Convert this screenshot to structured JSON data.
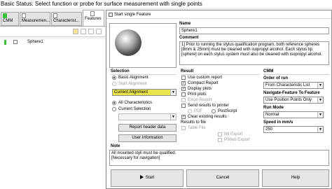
{
  "status_bar": {
    "text": "Basic Status: Select function or probe for surface measurement with single points"
  },
  "left_tabs": [
    {
      "label": "CMM"
    },
    {
      "label": "Measuremen..."
    },
    {
      "label": "Characterist..."
    },
    {
      "label": "Features"
    }
  ],
  "feature_list": [
    {
      "label": "Sphere1"
    }
  ],
  "dialog": {
    "title": "Start single Feature",
    "name_label": "Name",
    "name_value": "Sphere1",
    "comment_label": "Comment",
    "comment_text": "1] Prior to running the stylus qualification program, both reference spheres [8mm & 25mm] must be cleaned with isopropyl alcohol. Each stylus tip [sphere] on each stylus system must also be cleaned with isopropyl alcohol.",
    "selection": {
      "label": "Selection",
      "basic_alignment": "Basic Alignment",
      "start_alignment": "Start Alignment",
      "alignment_value": "Current Alignment",
      "all_characteristics": "All Characteristics",
      "current_selection": "Current Selection",
      "report_header_btn": "Report header data",
      "user_info_btn": "User Information"
    },
    "result": {
      "label": "Result",
      "use_custom_report": "Use custom report",
      "compact_report": "Compact Report",
      "display_plots": "Display plots",
      "print_plots": "Print plots",
      "excel_report": "Excel-Report",
      "send_results_printer": "Send results to printer",
      "pdf": "PDF",
      "postscript": "PostScript",
      "clear_existing_results": "Clear existing results",
      "results_to_file": "Results to file",
      "table_file": "Table File",
      "iw_export": "IW Export",
      "piweb_export": "PiWeb Export"
    },
    "cmm": {
      "label": "CMM",
      "order_of_run_label": "Order of run",
      "order_of_run_value": "From Characteristic List",
      "navigate_label": "Navigate-Feature To Feature",
      "navigate_value": "Use Position Points Only",
      "run_mode_label": "Run Mode",
      "run_mode_value": "Normal",
      "speed_label": "Speed in mm/s",
      "speed_value": "250"
    },
    "note": {
      "label": "Note",
      "text_line1": "All mounted styli must be qualified.",
      "text_line2": "[Necessary for navigation]"
    },
    "buttons": {
      "start": "Start",
      "cancel": "Cancel",
      "help": "Help"
    }
  },
  "colors": {
    "accent_green": "#3cbf3c",
    "alignment_highlight": "#e8e44c",
    "page_bg": "#f0f0f0"
  }
}
